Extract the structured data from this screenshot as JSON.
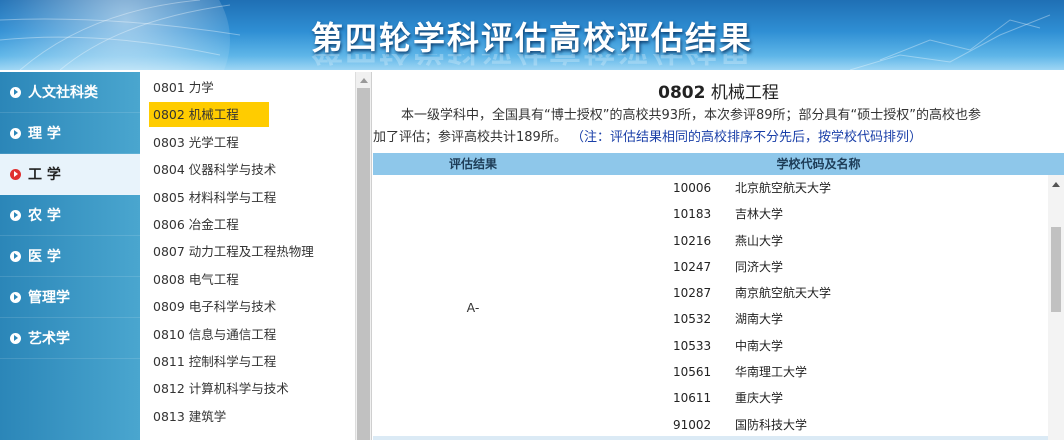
{
  "banner": {
    "title": "第四轮学科评估高校评估结果"
  },
  "categories": [
    {
      "label": "人文社科类",
      "active": false
    },
    {
      "label": "理 学",
      "active": false
    },
    {
      "label": "工 学",
      "active": true
    },
    {
      "label": "农 学",
      "active": false
    },
    {
      "label": "医 学",
      "active": false
    },
    {
      "label": "管理学",
      "active": false
    },
    {
      "label": "艺术学",
      "active": false
    }
  ],
  "subjects": [
    {
      "label": "0801 力学"
    },
    {
      "label": "0802 机械工程",
      "active": true
    },
    {
      "label": "0803 光学工程"
    },
    {
      "label": "0804 仪器科学与技术"
    },
    {
      "label": "0805 材料科学与工程"
    },
    {
      "label": "0806 冶金工程"
    },
    {
      "label": "0807 动力工程及工程热物理"
    },
    {
      "label": "0808 电气工程"
    },
    {
      "label": "0809 电子科学与技术"
    },
    {
      "label": "0810 信息与通信工程"
    },
    {
      "label": "0811 控制科学与工程"
    },
    {
      "label": "0812 计算机科学与技术"
    },
    {
      "label": "0813 建筑学"
    }
  ],
  "main": {
    "code": "0802",
    "name": "机械工程",
    "desc_line1": "本一级学科中，全国具有“博士授权”的高校共93所，本次参评89所；部分具有“硕士授权”的高校也参",
    "desc_line2": "加了评估；参评高校共计189所。",
    "note": "（注：评估结果相同的高校排序不分先后，按学校代码排列）",
    "table": {
      "col_result": "评估结果",
      "col_school": "学校代码及名称",
      "grade": "A-",
      "rows": [
        {
          "code": "10006",
          "name": "北京航空航天大学"
        },
        {
          "code": "10183",
          "name": "吉林大学"
        },
        {
          "code": "10216",
          "name": "燕山大学"
        },
        {
          "code": "10247",
          "name": "同济大学"
        },
        {
          "code": "10287",
          "name": "南京航空航天大学"
        },
        {
          "code": "10532",
          "name": "湖南大学"
        },
        {
          "code": "10533",
          "name": "中南大学"
        },
        {
          "code": "10561",
          "name": "华南理工大学"
        },
        {
          "code": "10611",
          "name": "重庆大学"
        },
        {
          "code": "91002",
          "name": "国防科技大学"
        }
      ]
    }
  },
  "colors": {
    "highlight": "#ffcc00",
    "header_band": "#8ec7ea",
    "nav_bg": "#2b86b8",
    "note_text": "#1a3fa8"
  }
}
